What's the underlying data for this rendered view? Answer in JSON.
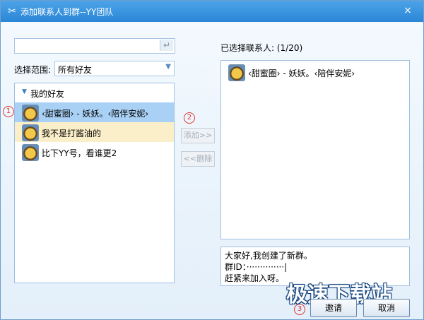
{
  "window": {
    "title": "添加联系人到群--YY团队",
    "close_glyph": "×"
  },
  "search": {
    "value": "",
    "enter_icon": "↵"
  },
  "scope": {
    "label": "选择范围:",
    "value": "所有好友"
  },
  "friends": {
    "group_label": "我的好友",
    "items": [
      {
        "name": "‹甜蜜圈›        - 妖妖。‹陪伴安妮›",
        "state": "selected"
      },
      {
        "name": "我不是打酱油的",
        "state": "hover"
      },
      {
        "name": "比下YY号，看谁更2",
        "state": "normal"
      }
    ]
  },
  "steps": {
    "one": "1",
    "two": "2",
    "three": "3"
  },
  "buttons": {
    "add": "添加>>",
    "remove": "<<删除",
    "invite": "邀请",
    "cancel": "取消"
  },
  "selected": {
    "label": "已选择联系人: (1/20)",
    "items": [
      {
        "name": "‹甜蜜圈›        - 妖妖。‹陪伴安妮›"
      }
    ]
  },
  "message": {
    "line1": "大家好,我创建了新群。",
    "line2": "群ID：··············|",
    "line3": "赶紧来加入呀。"
  },
  "watermark": "极速下载站",
  "colors": {
    "title_bar": "#2a86d6",
    "selected_row": "#a9d1f6",
    "hover_row": "#fbefc9",
    "step_marker": "#e0342f"
  }
}
